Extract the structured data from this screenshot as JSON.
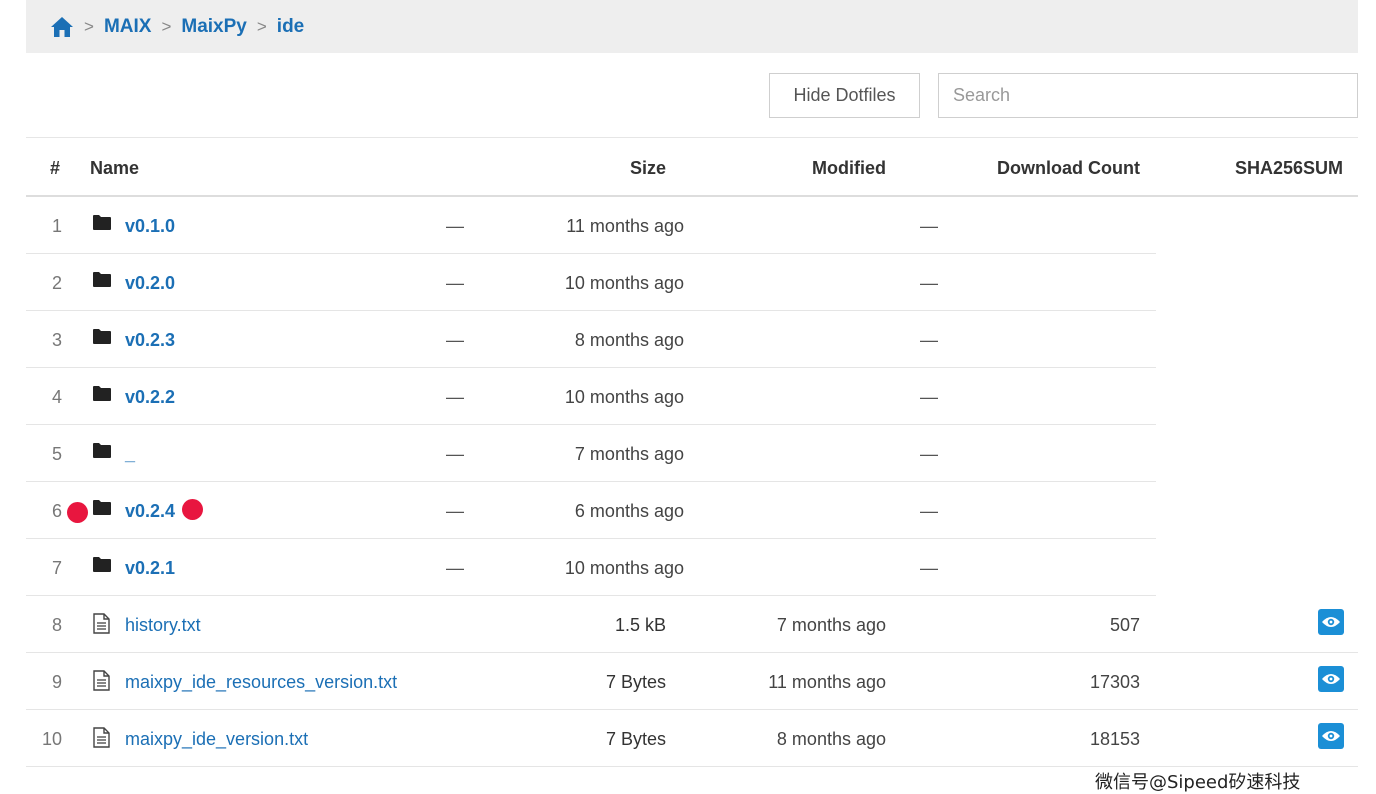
{
  "breadcrumb": {
    "items": [
      "MAIX",
      "MaixPy",
      "ide"
    ]
  },
  "toolbar": {
    "hide_dotfiles_label": "Hide Dotfiles",
    "search_placeholder": "Search"
  },
  "table": {
    "headers": {
      "num": "#",
      "name": "Name",
      "size": "Size",
      "modified": "Modified",
      "download_count": "Download Count",
      "sha": "SHA256SUM"
    },
    "rows": [
      {
        "num": "1",
        "name": "v0.1.0",
        "type": "dir",
        "size": "—",
        "modified": "11 months ago",
        "downloads": "—"
      },
      {
        "num": "2",
        "name": "v0.2.0",
        "type": "dir",
        "size": "—",
        "modified": "10 months ago",
        "downloads": "—"
      },
      {
        "num": "3",
        "name": "v0.2.3",
        "type": "dir",
        "size": "—",
        "modified": "8 months ago",
        "downloads": "—"
      },
      {
        "num": "4",
        "name": "v0.2.2",
        "type": "dir",
        "size": "—",
        "modified": "10 months ago",
        "downloads": "—"
      },
      {
        "num": "5",
        "name": "_",
        "type": "dir",
        "size": "—",
        "modified": "7 months ago",
        "downloads": "—"
      },
      {
        "num": "6",
        "name": "v0.2.4",
        "type": "dir",
        "size": "—",
        "modified": "6 months ago",
        "downloads": "—",
        "highlighted": true
      },
      {
        "num": "7",
        "name": "v0.2.1",
        "type": "dir",
        "size": "—",
        "modified": "10 months ago",
        "downloads": "—"
      },
      {
        "num": "8",
        "name": "history.txt",
        "type": "file",
        "size": "1.5 kB",
        "modified": "7 months ago",
        "downloads": "507",
        "sha_icon": "eye-icon"
      },
      {
        "num": "9",
        "name": "maixpy_ide_resources_version.txt",
        "type": "file",
        "size": "7 Bytes",
        "modified": "11 months ago",
        "downloads": "17303",
        "sha_icon": "eye-icon"
      },
      {
        "num": "10",
        "name": "maixpy_ide_version.txt",
        "type": "file",
        "size": "7 Bytes",
        "modified": "8 months ago",
        "downloads": "18153",
        "sha_icon": "eye-icon"
      }
    ]
  },
  "colors": {
    "link": "#1b6fb5",
    "marker": "#e8163f",
    "eye_button": "#1b8fd6"
  },
  "watermark": "微信号@Sipeed矽速科技"
}
